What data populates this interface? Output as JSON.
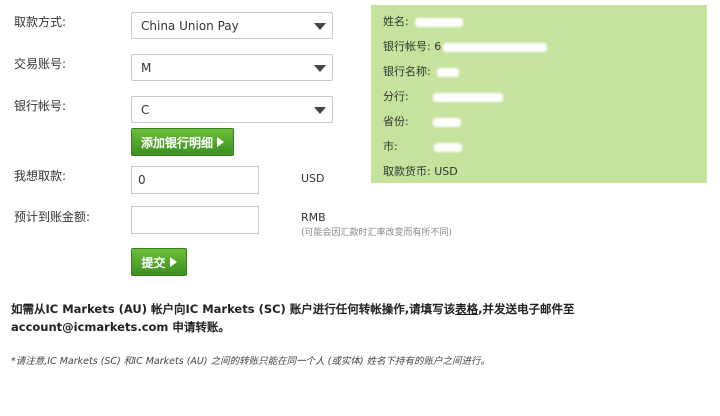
{
  "form": {
    "method_label": "取款方式:",
    "method_value": "China Union Pay",
    "account_label": "交易账号:",
    "account_value": "M",
    "bank_account_label": "银行帐号:",
    "bank_account_value": "C",
    "add_bank_button": "添加银行明细",
    "amount_label": "我想取款:",
    "amount_value": "0",
    "amount_currency": "USD",
    "estimate_label": "预计到账金额:",
    "estimate_value": "",
    "estimate_currency": "RMB",
    "estimate_hint": "(可能会因汇款时汇率改变而有所不同)",
    "submit_button": "提交"
  },
  "bank_panel": {
    "background": "#c5e39d",
    "rows": [
      {
        "label": "姓名:",
        "value": ""
      },
      {
        "label": "银行帐号:",
        "value": "6"
      },
      {
        "label": "银行名称:",
        "value": ""
      },
      {
        "label": "分行:",
        "value": ""
      },
      {
        "label": "省份:",
        "value": ""
      },
      {
        "label": "市:",
        "value": ""
      },
      {
        "label": "取款货币:",
        "value": "USD"
      }
    ]
  },
  "notice": {
    "text_before": "如需从IC Markets (AU) 帐户向IC Markets (SC) 账户进行任何转帐操作,请填写该",
    "link": "表格",
    "text_after": ",并发送电子邮件至account@icmarkets.com 申请转账。"
  },
  "footnote": "*请注意,IC Markets (SC) 和IC Markets (AU) 之间的转账只能在同一个人 (或实体) 姓名下持有的账户之间进行。",
  "colors": {
    "button_green": "#4fa52a",
    "panel_green": "#c5e39d"
  },
  "icons": {
    "dropdown": "chevron-down-icon",
    "button_arrow": "triangle-right-icon"
  }
}
